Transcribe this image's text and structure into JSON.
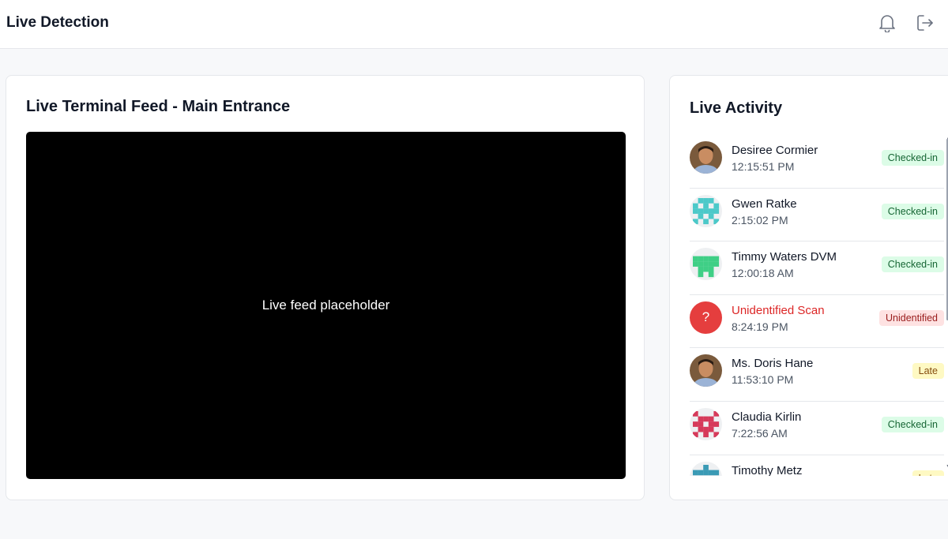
{
  "header": {
    "title": "Live Detection",
    "icons": {
      "bell": "bell-icon",
      "logout": "logout-icon"
    }
  },
  "feed": {
    "title": "Live Terminal Feed - Main Entrance",
    "placeholder": "Live feed placeholder"
  },
  "activity": {
    "title": "Live Activity",
    "items": [
      {
        "name": "Desiree Cormier",
        "time": "12:15:51 PM",
        "status": "Checked-in",
        "kind": "checked",
        "avatar": "photo"
      },
      {
        "name": "Gwen Ratke",
        "time": "2:15:02 PM",
        "status": "Checked-in",
        "kind": "checked",
        "avatar": "identicon",
        "color": "#4cc9c9"
      },
      {
        "name": "Timmy Waters DVM",
        "time": "12:00:18 AM",
        "status": "Checked-in",
        "kind": "checked",
        "avatar": "identicon",
        "color": "#3fcf86"
      },
      {
        "name": "Unidentified Scan",
        "time": "8:24:19 PM",
        "status": "Unidentified",
        "kind": "unidentified",
        "avatar": "question",
        "glyph": "?"
      },
      {
        "name": "Ms. Doris Hane",
        "time": "11:53:10 PM",
        "status": "Late",
        "kind": "late",
        "avatar": "photo"
      },
      {
        "name": "Claudia Kirlin",
        "time": "7:22:56 AM",
        "status": "Checked-in",
        "kind": "checked",
        "avatar": "identicon",
        "color": "#d63a5a"
      },
      {
        "name": "Timothy Metz",
        "time": "",
        "status": "Late",
        "kind": "late",
        "avatar": "identicon",
        "color": "#3a9ab5"
      }
    ]
  },
  "colors": {
    "checked_bg": "#dcfce7",
    "checked_text": "#166534",
    "unidentified_bg": "#fee2e2",
    "unidentified_text": "#991b1b",
    "late_bg": "#fef9c3",
    "late_text": "#854d0e",
    "danger": "#dc2626"
  }
}
